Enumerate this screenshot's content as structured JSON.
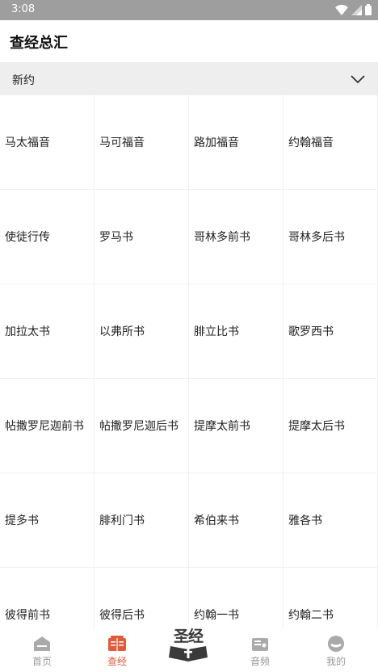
{
  "status_bar": {
    "time": "3:08"
  },
  "app_bar": {
    "title": "查经总汇"
  },
  "section": {
    "label": "新约"
  },
  "books": [
    "马太福音",
    "马可福音",
    "路加福音",
    "约翰福音",
    "使徒行传",
    "罗马书",
    "哥林多前书",
    "哥林多后书",
    "加拉太书",
    "以弗所书",
    "腓立比书",
    "歌罗西书",
    "帖撒罗尼迦前书",
    "帖撒罗尼迦后书",
    "提摩太前书",
    "提摩太后书",
    "提多书",
    "腓利门书",
    "希伯来书",
    "雅各书",
    "彼得前书",
    "彼得后书",
    "约翰一书",
    "约翰二书"
  ],
  "bottom_nav": {
    "home": "首页",
    "study": "查经",
    "logo_text": "圣经",
    "audio": "音频",
    "mine": "我的"
  },
  "colors": {
    "accent": "#e25a3c",
    "inactive": "#999999"
  }
}
